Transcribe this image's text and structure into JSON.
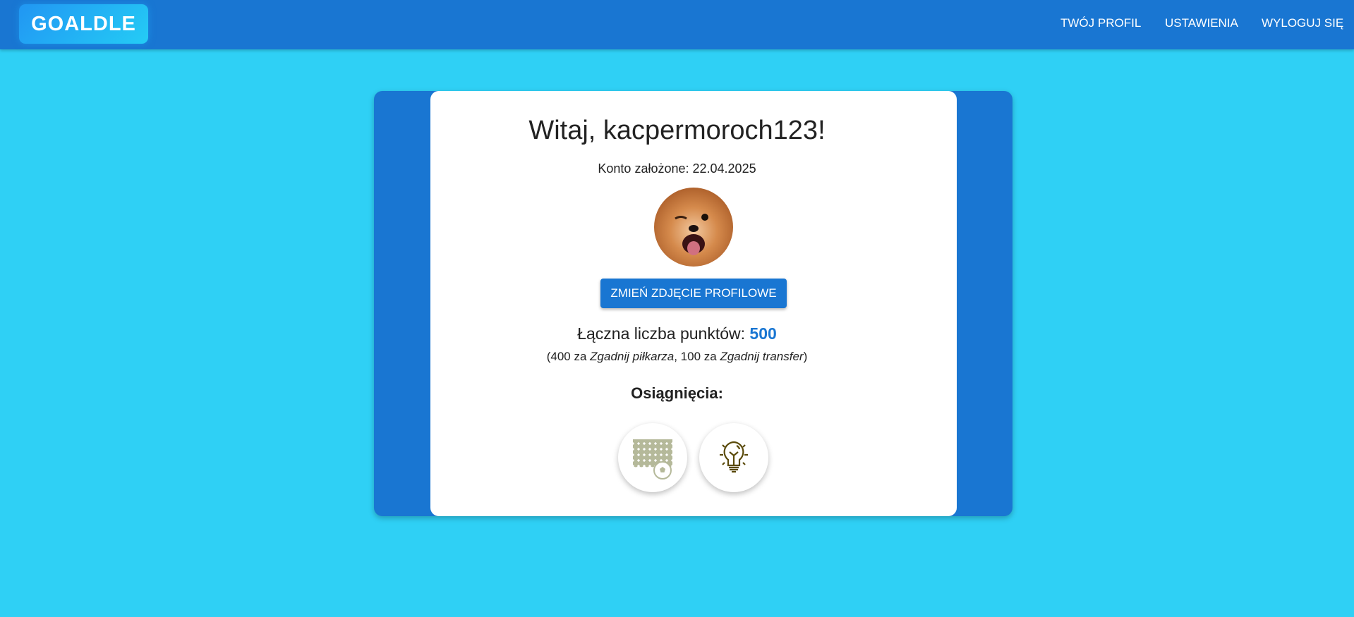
{
  "nav": {
    "logo": "GOALDLE",
    "links": [
      "TWÓJ PROFIL",
      "USTAWIENIA",
      "WYLOGUJ SIĘ"
    ]
  },
  "profile": {
    "greeting": "Witaj, kacpermoroch123!",
    "created": "Konto założone: 22.04.2025",
    "avatar_icon": "dog-photo",
    "change_photo_label": "ZMIEŃ ZDJĘCIE PROFILOWE",
    "points_label": "Łączna liczba punktów: ",
    "points_value": "500",
    "breakdown": {
      "open": "(400 za ",
      "game1": "Zgadnij piłkarza",
      "mid": ", 100 za ",
      "game2": "Zgadnij transfer",
      "close": ")"
    },
    "achievements_title": "Osiągnięcia:",
    "achievements": [
      {
        "icon": "goal-net-ball-icon",
        "color": "#b5b99a"
      },
      {
        "icon": "lightbulb-icon",
        "color": "#5a4a0a"
      }
    ]
  },
  "colors": {
    "nav": "#1976d2",
    "background": "#2fd0f5",
    "accent": "#1976d2"
  }
}
